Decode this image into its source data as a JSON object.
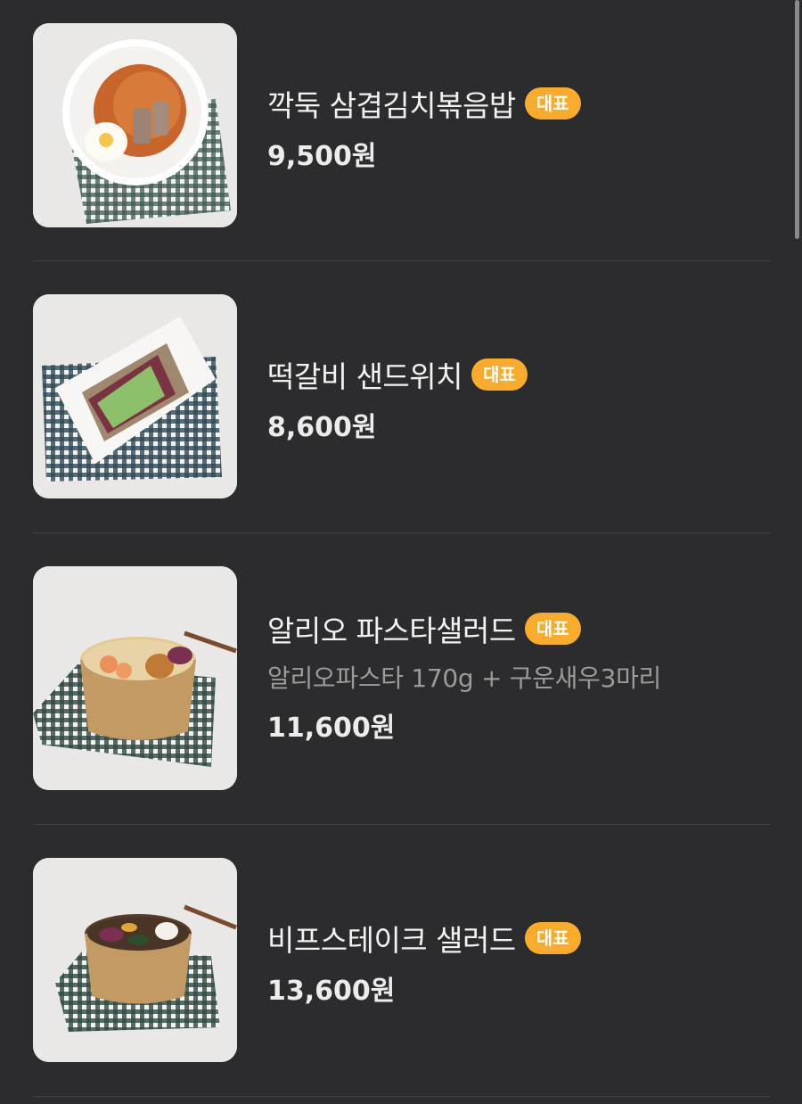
{
  "menu": {
    "items": [
      {
        "name": "깍둑 삼겹김치볶음밥",
        "badge": "대표",
        "description": "",
        "price": "9,500원",
        "image": "kimchi-fried-rice-bowl"
      },
      {
        "name": "떡갈비 샌드위치",
        "badge": "대표",
        "description": "",
        "price": "8,600원",
        "image": "tteokgalbi-sandwich-plate"
      },
      {
        "name": "알리오 파스타샐러드",
        "badge": "대표",
        "description": "알리오파스타 170g + 구운새우3마리",
        "price": "11,600원",
        "image": "aglio-pasta-salad-bowl"
      },
      {
        "name": "비프스테이크 샐러드",
        "badge": "대표",
        "description": "",
        "price": "13,600원",
        "image": "beef-steak-salad-bowl"
      }
    ]
  },
  "colors": {
    "background": "#2c2c2e",
    "badge": "#f9ab2b",
    "divider": "#414144"
  }
}
